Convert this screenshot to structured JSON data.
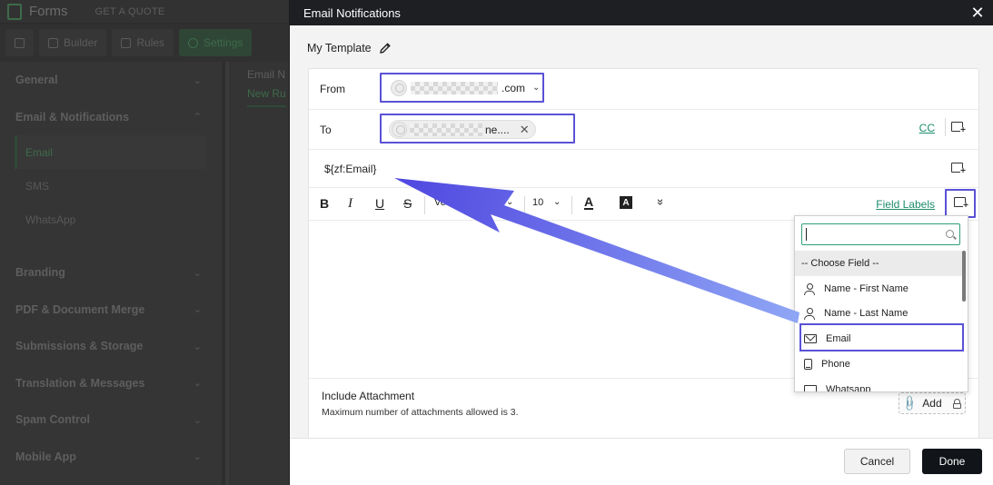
{
  "background": {
    "app_name": "Forms",
    "get_quote": "GET A QUOTE",
    "tabs": [
      {
        "label": "Builder"
      },
      {
        "label": "Rules"
      },
      {
        "label": "Settings"
      }
    ],
    "sidebar": {
      "general": "General",
      "email_notifications": "Email & Notifications",
      "sub": [
        "Email",
        "SMS",
        "WhatsApp"
      ],
      "items": [
        "Branding",
        "PDF & Document Merge",
        "Submissions & Storage",
        "Translation & Messages",
        "Spam Control",
        "Mobile App"
      ]
    },
    "main_title": "Email N",
    "main_tab": "New Ru"
  },
  "modal": {
    "title": "Email Notifications",
    "template_name": "My Template",
    "from_label": "From",
    "from_value_suffix": ".com",
    "to_label": "To",
    "to_chip_suffix": "ne....",
    "cc_label": "CC",
    "subject": "${zf:Email}",
    "toolbar": {
      "bold": "B",
      "italic": "I",
      "underline": "U",
      "strike": "S",
      "font": "Verd",
      "size": "10",
      "font_color": "A",
      "bg_color": "A",
      "field_labels": "Field Labels"
    },
    "attachment": {
      "title": "Include Attachment",
      "subtitle": "Maximum number of attachments allowed is 3.",
      "add_label": "Add"
    },
    "footer": {
      "cancel": "Cancel",
      "done": "Done"
    }
  },
  "field_dropdown": {
    "search_value": "",
    "heading": "-- Choose Field --",
    "items": [
      {
        "label": "Name - First Name",
        "icon": "person-icon"
      },
      {
        "label": "Name - Last Name",
        "icon": "person-icon"
      },
      {
        "label": "Email",
        "icon": "mail-icon"
      },
      {
        "label": "Phone",
        "icon": "phone-icon"
      },
      {
        "label": "Whatsapp",
        "icon": "whatsapp-icon"
      }
    ]
  },
  "colors": {
    "highlight": "#5a52d6",
    "arrow": "#5a52e0",
    "link": "#1d8d6d",
    "header": "#1d1f23"
  }
}
